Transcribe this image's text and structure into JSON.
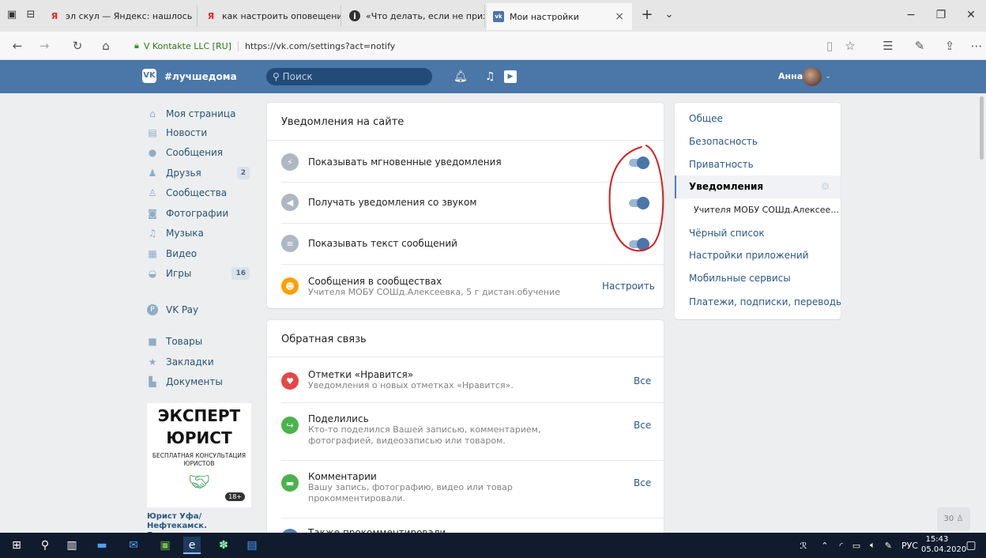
{
  "browser": {
    "tabs": [
      {
        "label": "эл скул — Яндекс: нашлось",
        "favicon": "yandex-icon"
      },
      {
        "label": "как настроить оповещени",
        "favicon": "yandex-icon"
      },
      {
        "label": "«Что делать, если не прихс",
        "favicon": "info-icon"
      },
      {
        "label": "Мои настройки",
        "favicon": "vk-icon",
        "active": true
      }
    ],
    "cert_label": "V Kontakte LLC [RU]",
    "url": "https://vk.com/settings?act=notify"
  },
  "header": {
    "logo": "VK",
    "hashtag": "#лучшедома",
    "search_placeholder": "Поиск",
    "username": "Анна"
  },
  "left_menu": [
    {
      "label": "Моя страница",
      "icon": "home-icon"
    },
    {
      "label": "Новости",
      "icon": "news-icon"
    },
    {
      "label": "Сообщения",
      "icon": "messages-icon"
    },
    {
      "label": "Друзья",
      "icon": "friends-icon",
      "count": "2"
    },
    {
      "label": "Сообщества",
      "icon": "groups-icon"
    },
    {
      "label": "Фотографии",
      "icon": "camera-icon"
    },
    {
      "label": "Музыка",
      "icon": "music-icon"
    },
    {
      "label": "Видео",
      "icon": "video-icon"
    },
    {
      "label": "Игры",
      "icon": "games-icon",
      "count": "16"
    },
    {
      "label": "VK Pay",
      "icon": "vkpay-icon"
    },
    {
      "label": "Товары",
      "icon": "bag-icon"
    },
    {
      "label": "Закладки",
      "icon": "star-icon"
    },
    {
      "label": "Документы",
      "icon": "document-icon"
    }
  ],
  "ad": {
    "title1": "ЭКСПЕРТ",
    "title2": "ЮРИСТ",
    "tagline": "БЕСПЛАТНАЯ КОНСУЛЬТАЦИЯ ЮРИСТОВ",
    "age": "18+",
    "caption": "Юрист Уфа/Нефтекамск. Бесплатная"
  },
  "site_notifications": {
    "title": "Уведомления на сайте",
    "rows": [
      {
        "label": "Показывать мгновенные уведомления",
        "on": true
      },
      {
        "label": "Получать уведомления со звуком",
        "on": true
      },
      {
        "label": "Показывать текст сообщений",
        "on": true
      }
    ],
    "community": {
      "label": "Сообщения в сообществах",
      "sub": "Учителя МОБУ СОШд.Алексеевка, 5 г дистан.обучение",
      "action": "Настроить"
    }
  },
  "feedback": {
    "title": "Обратная связь",
    "rows": [
      {
        "label": "Отметки «Нравится»",
        "sub": "Уведомления о новых отметках «Нравится».",
        "action": "Все",
        "color": "#e64646"
      },
      {
        "label": "Поделились",
        "sub1": "Кто-то поделился Вашей записью, комментарием,",
        "sub2": "фотографией, видеозаписью или товаром.",
        "action": "Все",
        "color": "#4bb34b"
      },
      {
        "label": "Комментарии",
        "sub1": "Вашу запись, фотографию, видео или товар",
        "sub2": "прокомментировали.",
        "action": "Все",
        "color": "#4bb34b"
      },
      {
        "label": "Также прокомментировали",
        "color": "#5181b8"
      }
    ]
  },
  "right_nav": [
    {
      "label": "Общее"
    },
    {
      "label": "Безопасность"
    },
    {
      "label": "Приватность"
    },
    {
      "label": "Уведомления",
      "active": true
    },
    {
      "label": "Учителя МОБУ СОШд.Алексее..."
    },
    {
      "label": "Чёрный список"
    },
    {
      "label": "Настройки приложений"
    },
    {
      "label": "Мобильные сервисы"
    },
    {
      "label": "Платежи, подписки, переводы"
    }
  ],
  "online_count": "30",
  "taskbar": {
    "lang": "РУС",
    "time": "15:43",
    "date": "05.04.2020"
  },
  "colors": {
    "vk_blue": "#4a76a8",
    "annotation_red": "#d42020"
  }
}
